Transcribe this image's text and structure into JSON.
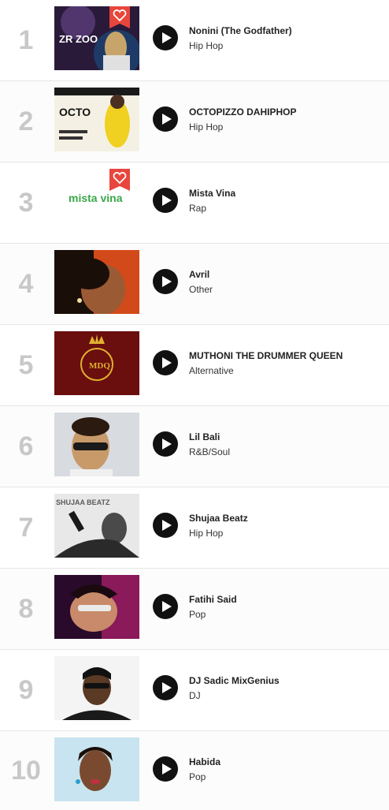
{
  "chart": {
    "entries": [
      {
        "rank": "1",
        "artist": "Nonini (The Godfather)",
        "genre": "Hip Hop",
        "thumb_text": "ZR ZOO"
      },
      {
        "rank": "2",
        "artist": "OCTOPIZZO DAHIPHOP",
        "genre": "Hip Hop",
        "thumb_text": "OCTO"
      },
      {
        "rank": "3",
        "artist": "Mista Vina",
        "genre": "Rap",
        "thumb_text": "mista vina"
      },
      {
        "rank": "4",
        "artist": "Avril",
        "genre": "Other",
        "thumb_text": ""
      },
      {
        "rank": "5",
        "artist": "MUTHONI THE DRUMMER QUEEN",
        "genre": "Alternative",
        "thumb_text": "MDQ"
      },
      {
        "rank": "6",
        "artist": "Lil Bali",
        "genre": "R&B/Soul",
        "thumb_text": ""
      },
      {
        "rank": "7",
        "artist": "Shujaa Beatz",
        "genre": "Hip Hop",
        "thumb_text": "SHUJAA BEATZ"
      },
      {
        "rank": "8",
        "artist": "Fatihi Said",
        "genre": "Pop",
        "thumb_text": ""
      },
      {
        "rank": "9",
        "artist": "DJ Sadic MixGenius",
        "genre": "DJ",
        "thumb_text": ""
      },
      {
        "rank": "10",
        "artist": "Habida",
        "genre": "Pop",
        "thumb_text": ""
      }
    ]
  },
  "icons": {
    "play": "play-icon",
    "favorite": "heart-icon"
  },
  "colors": {
    "rank": "#c8c8c8",
    "play_button": "#111111",
    "favorite_badge": "#e8463c"
  }
}
